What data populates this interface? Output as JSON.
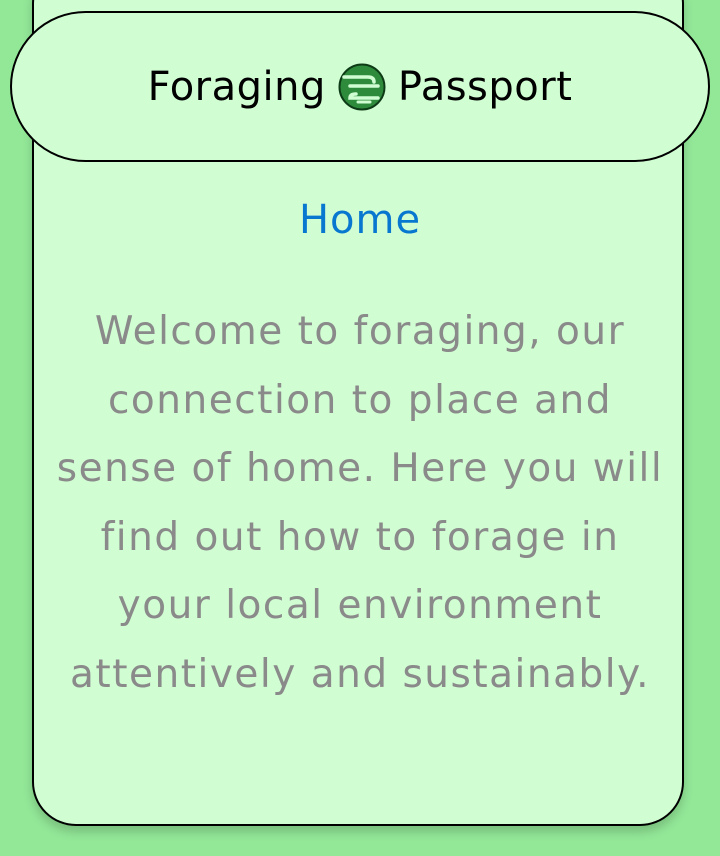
{
  "header": {
    "title_left": "Foraging",
    "title_right": "Passport",
    "logo_icon": "globe-leaf-icon"
  },
  "main": {
    "page_title": "Home",
    "intro_text": "Welcome to foraging, our connection to place and sense of home. Here you will find out how to forage in your local environment attentively and sustainably."
  },
  "colors": {
    "background": "#93e898",
    "card": "#d1fdd3",
    "title_accent": "#0877cf",
    "body_text": "#8a8a8a",
    "logo_green": "#2e8b3c"
  }
}
